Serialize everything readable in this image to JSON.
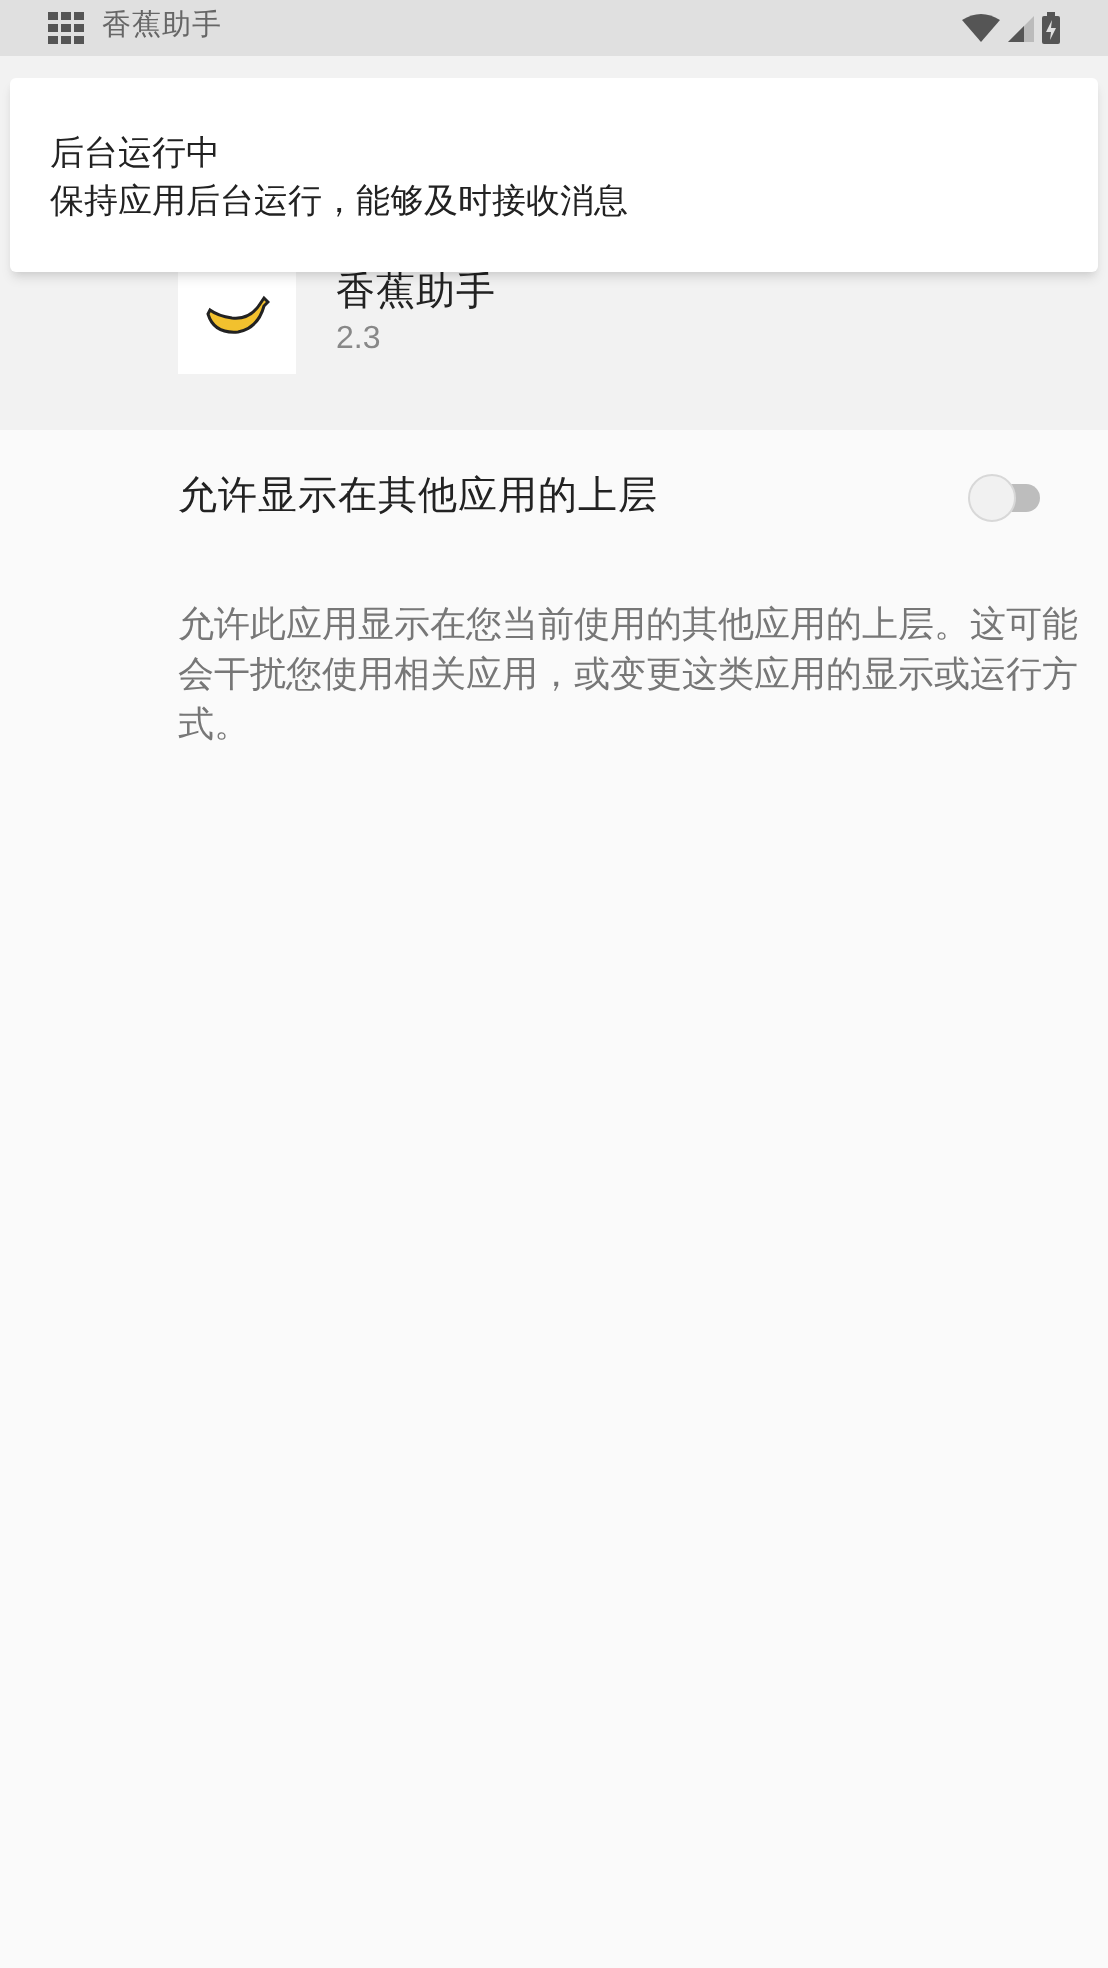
{
  "status_bar": {
    "app_title": "香蕉助手"
  },
  "notification": {
    "title": "后台运行中",
    "message": "保持应用后台运行，能够及时接收消息"
  },
  "app": {
    "name": "香蕉助手",
    "version": "2.3"
  },
  "setting": {
    "label": "允许显示在其他应用的上层",
    "on": false,
    "description": "允许此应用显示在您当前使用的其他应用的上层。这可能会干扰您使用相关应用，或变更这类应用的显示或运行方式。"
  }
}
